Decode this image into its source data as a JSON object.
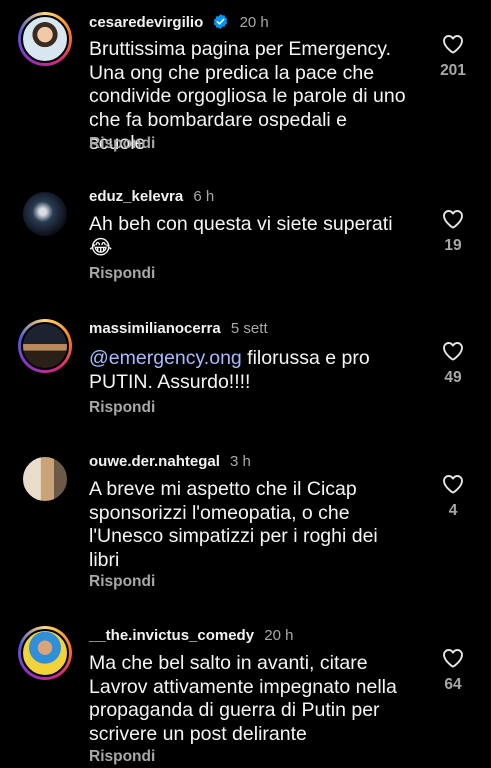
{
  "comments": [
    {
      "username": "cesaredevirgilio",
      "time": "20 h",
      "verified": true,
      "text": "Bruttissima pagina per Emergency. Una ong che predica la pace che condivide orgogliosa le parole di uno che fa bombardare ospedali e scuole",
      "reply": "Rispondi",
      "likes": "201"
    },
    {
      "username": "eduz_kelevra",
      "time": "6 h",
      "text": "Ah beh con questa vi siete superati",
      "emoji": "😂",
      "reply": "Rispondi",
      "likes": "19"
    },
    {
      "username": "massimilianocerra",
      "time": "5 sett",
      "mention": "@emergency.ong",
      "text": " filorussa e pro PUTIN. Assurdo!!!!",
      "reply": "Rispondi",
      "likes": "49"
    },
    {
      "username": "ouwe.der.nahtegal",
      "time": "3 h",
      "text": "A breve mi aspetto che il Cicap sponsorizzi l'omeopatia, o che l'Unesco simpatizzi per i roghi dei libri",
      "reply": "Rispondi",
      "likes": "4"
    },
    {
      "username": "__the.invictus_comedy",
      "time": "20 h",
      "text": "Ma che bel salto in avanti, citare Lavrov attivamente impegnato nella propaganda di guerra di Putin per scrivere un post delirante",
      "reply": "Rispondi",
      "likes": "64"
    }
  ],
  "icons": {
    "like": "heart-outline-icon",
    "verified": "verified-badge-icon"
  },
  "colors": {
    "background": "#000000",
    "mention": "#a9b9ff",
    "verified": "#0095f6",
    "muted": "#a8a8a8"
  }
}
